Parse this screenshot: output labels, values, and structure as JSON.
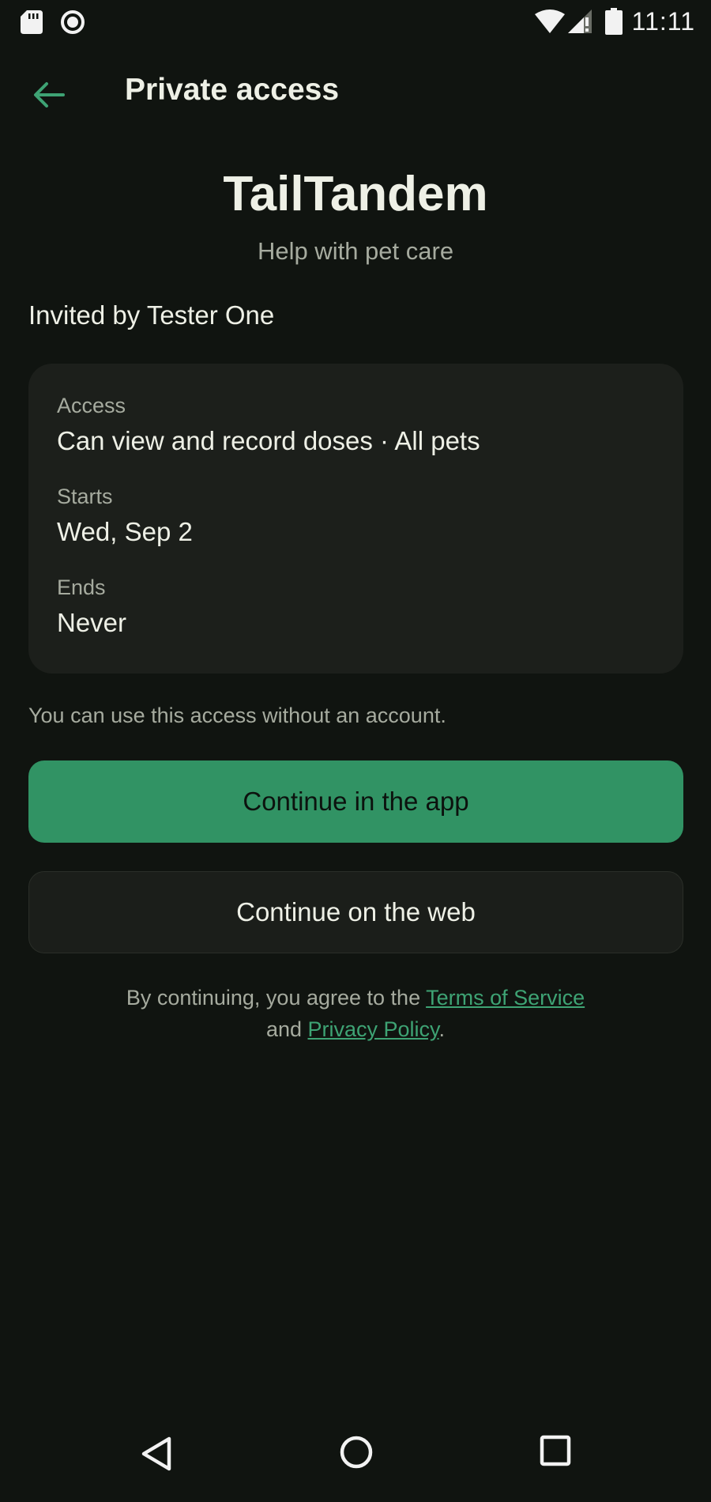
{
  "status_bar": {
    "time": "11:11",
    "icons": [
      "sd-card-icon",
      "record-icon",
      "wifi-icon",
      "signal-icon",
      "battery-icon"
    ]
  },
  "app_bar": {
    "title": "Private access",
    "back_icon": "arrow-left-icon"
  },
  "header": {
    "app_name": "TailTandem",
    "tagline": "Help with pet care"
  },
  "invitation": {
    "invited_by": "Invited by Tester One"
  },
  "details": {
    "access_label": "Access",
    "access_value": "Can view and record doses · All pets",
    "starts_label": "Starts",
    "starts_value": "Wed, Sep 2",
    "ends_label": "Ends",
    "ends_value": "Never"
  },
  "note": "You can use this access without an account.",
  "actions": {
    "primary_label": "Continue in the app",
    "secondary_label": "Continue on the web"
  },
  "legal": {
    "prefix": "By continuing, you agree to the ",
    "terms_link": "Terms of Service",
    "middle": "and ",
    "privacy_link": "Privacy Policy",
    "suffix": "."
  },
  "nav_bar": {
    "icons": [
      "nav-back-icon",
      "nav-home-icon",
      "nav-recents-icon"
    ]
  },
  "colors": {
    "background": "#101410",
    "card": "#1c1f1b",
    "accent": "#319364",
    "link": "#3ea374",
    "muted_text": "#a6ab9f",
    "text": "#eef0e6"
  }
}
